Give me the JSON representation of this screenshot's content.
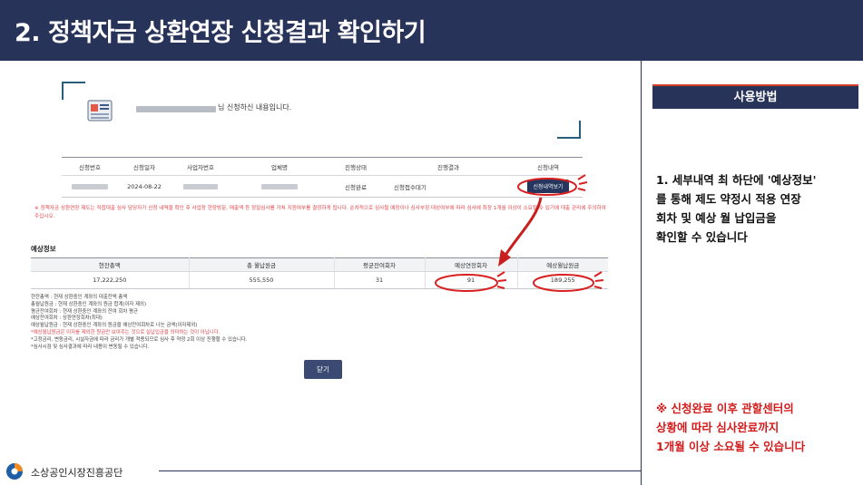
{
  "header": {
    "title": "2. 정책자금 상환연장 신청결과 확인하기"
  },
  "info_box": {
    "message": "님 신청하신 내용입니다."
  },
  "result_table": {
    "headers": [
      "신청번호",
      "신청일자",
      "사업자번호",
      "업체명",
      "진행상태",
      "진행결과",
      "신청내역"
    ],
    "row": {
      "date": "2024-08-22",
      "status": "신청완료",
      "result": "신청접수대기",
      "detail_button": "신청내역보기"
    }
  },
  "notice": "※ 정책자금 상환연장 제도는 직접대출 심사 담당자가 신청 내역을 확인 후 사업장 현장방문, 매출액 등 정밀심사를 거쳐 지원여부를 결정하게 됩니다. 순차적으로 심사될 예정이나 심사부정 대상여부에 따라 심사에 최장 1개월 이상이 소요될 수 있기에 대출 관리에 주의하여 주십시오.",
  "estimate": {
    "title": "예상정보",
    "headers": [
      "현잔총액",
      "총 월납원금",
      "평균잔여회차",
      "예상연장회차",
      "예상월납원금"
    ],
    "values": [
      "17,222,250",
      "555,550",
      "31",
      "91",
      "189,255"
    ]
  },
  "legend": [
    {
      "text": "현잔총액 : 현재 상환중인 계좌의 대출잔액 총액",
      "red": false
    },
    {
      "text": "총월납원금 : 현재 상환중인 계좌의 원금 합계(이자 제외)",
      "red": false
    },
    {
      "text": "평균잔여회차 : 현재 상환중인 계좌의 잔여 회차 평균",
      "red": false
    },
    {
      "text": "예상잔여회차 : 상환연장회차(최대)",
      "red": false
    },
    {
      "text": "예상월납원금 : 현재 상환중인 계좌의 원금을 예상잔여회차로 나눈 금액(이자제외)",
      "red": false
    },
    {
      "text": "*예상월납원금은 이자를 제외한 원금만 보여주는 것으로 실납입금을 의미하는 것이 아닙니다.",
      "red": true
    },
    {
      "text": "*고정금리, 변동금리, 시설자금에 따라 금리가 개별 적용되므로 심사 후 약정 2회 이상 진행할 수 있습니다.",
      "red": false
    },
    {
      "text": "*심사시점 및 심사결과에 따라 내용이 변동될 수 있습니다.",
      "red": false
    }
  ],
  "close_button": "닫기",
  "side": {
    "how_title": "사용방법",
    "step_text": "1. 세부내역 최 하단에 '예상정보'\n   를 통해 제도 약정시 적용 연장\n   회차 및 예상 월 납입금을\n   확인할 수 있습니다",
    "note_text": "※ 신청완료 이후 관할센터의\n   상황에 따라 심사완료까지\n   1개월 이상 소요될 수 있습니다"
  },
  "footer": {
    "org": "소상공인시장진흥공단"
  },
  "colors": {
    "navy": "#28335a",
    "accent_red": "#d21b1b"
  }
}
